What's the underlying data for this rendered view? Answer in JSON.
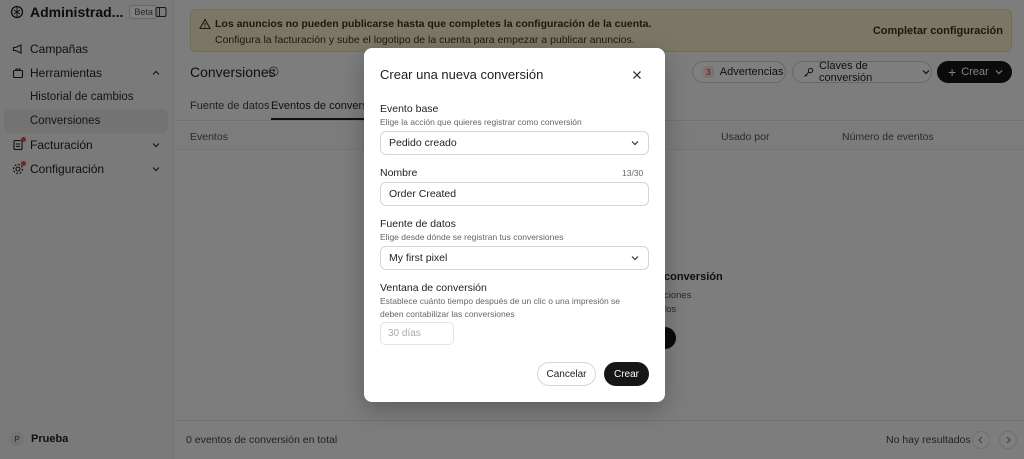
{
  "sidebar": {
    "title": "Administrad...",
    "badge": "Beta",
    "items": [
      {
        "label": "Campañas"
      },
      {
        "label": "Herramientas"
      },
      {
        "label": "Facturación"
      },
      {
        "label": "Configuración"
      }
    ],
    "subitems": [
      {
        "label": "Historial de cambios"
      },
      {
        "label": "Conversiones"
      }
    ],
    "user_initial": "P",
    "user_name": "Prueba"
  },
  "banner": {
    "title": "Los anuncios no pueden publicarse hasta que completes la configuración de la cuenta.",
    "text": "Configura la facturación y sube el logotipo de la cuenta para empezar a publicar anuncios.",
    "cta": "Completar configuración"
  },
  "header": {
    "title": "Conversiones",
    "warnings_count": "3",
    "warnings_label": "Advertencias",
    "keys_label": "Claves de conversión",
    "create_label": "Crear"
  },
  "tabs": [
    {
      "label": "Fuente de datos"
    },
    {
      "label": "Eventos de conversión"
    }
  ],
  "table": {
    "columns": [
      "Eventos",
      "Usado por",
      "Número de eventos"
    ]
  },
  "empty_fragments": [
    "conversión",
    "ciones",
    "los"
  ],
  "footer": {
    "total": "0 eventos de conversión en total",
    "results": "No hay resultados"
  },
  "modal": {
    "title": "Crear una nueva conversión",
    "base_event": {
      "label": "Evento base",
      "hint": "Elige la acción que quieres registrar como conversión",
      "value": "Pedido creado"
    },
    "name": {
      "label": "Nombre",
      "counter": "13/30",
      "value": "Order Created"
    },
    "data_source": {
      "label": "Fuente de datos",
      "hint": "Elige desde dónde se registran tus conversiones",
      "value": "My first pixel"
    },
    "window": {
      "label": "Ventana de conversión",
      "hint": "Establece cuánto tiempo después de un clic o una impresión se deben contabilizar las conversiones",
      "placeholder": "30 días"
    },
    "cancel_label": "Cancelar",
    "create_label": "Crear"
  },
  "colors": {
    "accent": "#161616",
    "banner_bg": "#f6efcf",
    "alert_dot": "#e5484d"
  }
}
